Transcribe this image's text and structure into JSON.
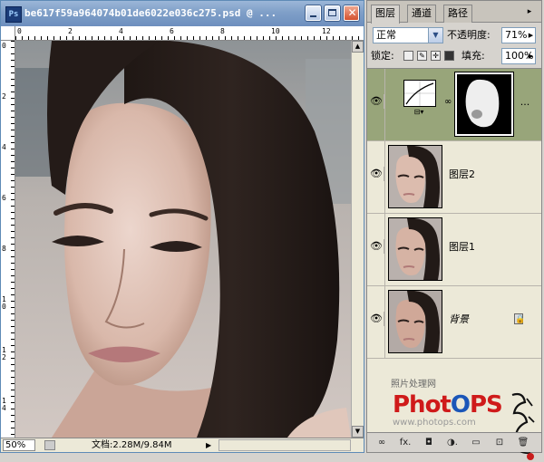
{
  "document": {
    "title": "be617f59a964074b01de6022e036c275.psd @ ...",
    "ps_icon": "Ps",
    "ruler_top": [
      "0",
      "2",
      "4",
      "6",
      "8",
      "10",
      "12"
    ],
    "ruler_left": [
      "0",
      "2",
      "4",
      "6",
      "8",
      "10",
      "12",
      "14"
    ],
    "status": {
      "zoom": "50%",
      "doc_info": "文档:2.28M/9.84M",
      "arrow": "▶"
    }
  },
  "layers_palette": {
    "tabs": [
      "图层",
      "通道",
      "路径"
    ],
    "active_tab": "图层",
    "tab_menu": "▸",
    "blend_mode": "正常",
    "opacity_label": "不透明度:",
    "opacity_value": "71%",
    "lock_label": "锁定:",
    "fill_label": "填充:",
    "fill_value": "100%",
    "layers": [
      {
        "name": "",
        "type": "adjustment-with-mask",
        "selected": true,
        "visible": true,
        "more": "..."
      },
      {
        "name": "图层2",
        "type": "image",
        "selected": false,
        "visible": true
      },
      {
        "name": "图层1",
        "type": "image",
        "selected": false,
        "visible": true
      },
      {
        "name": "背景",
        "type": "background",
        "selected": false,
        "visible": true,
        "locked": true
      }
    ],
    "watermark": {
      "site_cn": "照片处理网",
      "logo_part1": "Phot",
      "logo_part2": "O",
      "logo_part3": "PS",
      "url": "www.photops.com"
    },
    "bottom_icons": [
      "link-icon",
      "fx-icon",
      "mask-icon",
      "adjustment-icon",
      "folder-icon",
      "new-layer-icon",
      "trash-icon"
    ],
    "bottom_labels": [
      "∞",
      "fx.",
      "◘",
      "◑.",
      "▭",
      "⊡",
      "🗑"
    ]
  },
  "colors": {
    "selected_layer": "#98a57a",
    "titlebar": "#7f9fc8",
    "logo_red": "#cf1a1a",
    "logo_blue": "#1b56b8"
  }
}
